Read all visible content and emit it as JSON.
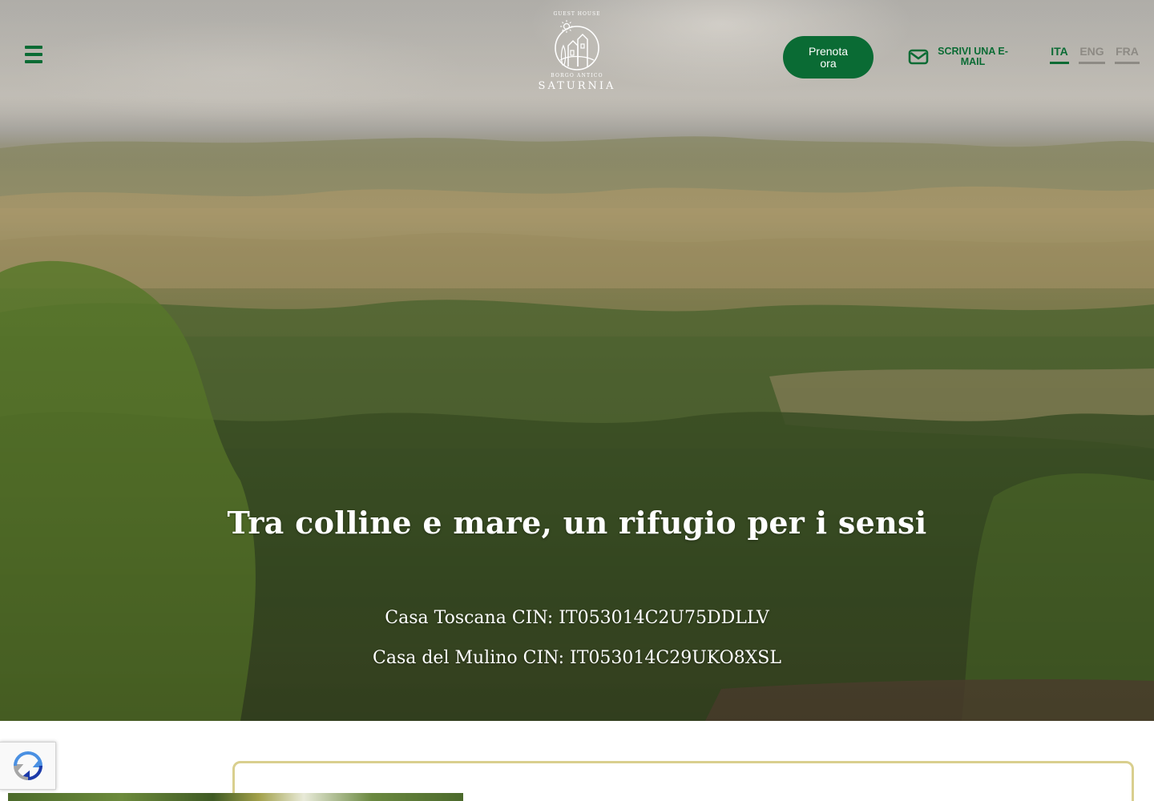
{
  "header": {
    "menu_icon": "hamburger-menu-icon",
    "logo": {
      "top_text": "GUEST HOUSE",
      "sub_text": "BORGO ANTICO",
      "name": "SATURNIA"
    },
    "book_button": "Prenota ora",
    "email_link": "SCRIVI UNA E-MAIL",
    "email_icon": "envelope-icon",
    "languages": [
      {
        "code": "ITA",
        "active": true
      },
      {
        "code": "ENG",
        "active": false
      },
      {
        "code": "FRA",
        "active": false
      }
    ]
  },
  "hero": {
    "title": "Tra colline e mare, un rifugio per i sensi",
    "cin_lines": [
      "Casa Toscana CIN: IT053014C2U75DDLLV",
      "Casa del Mulino CIN: IT053014C29UKO8XSL"
    ]
  },
  "widgets": {
    "recaptcha_icon": "recaptcha-icon"
  },
  "colors": {
    "brand_green": "#0a6b34",
    "card_border_gold": "#d9cf8e",
    "inactive_lang_gray": "#8d8a84"
  }
}
